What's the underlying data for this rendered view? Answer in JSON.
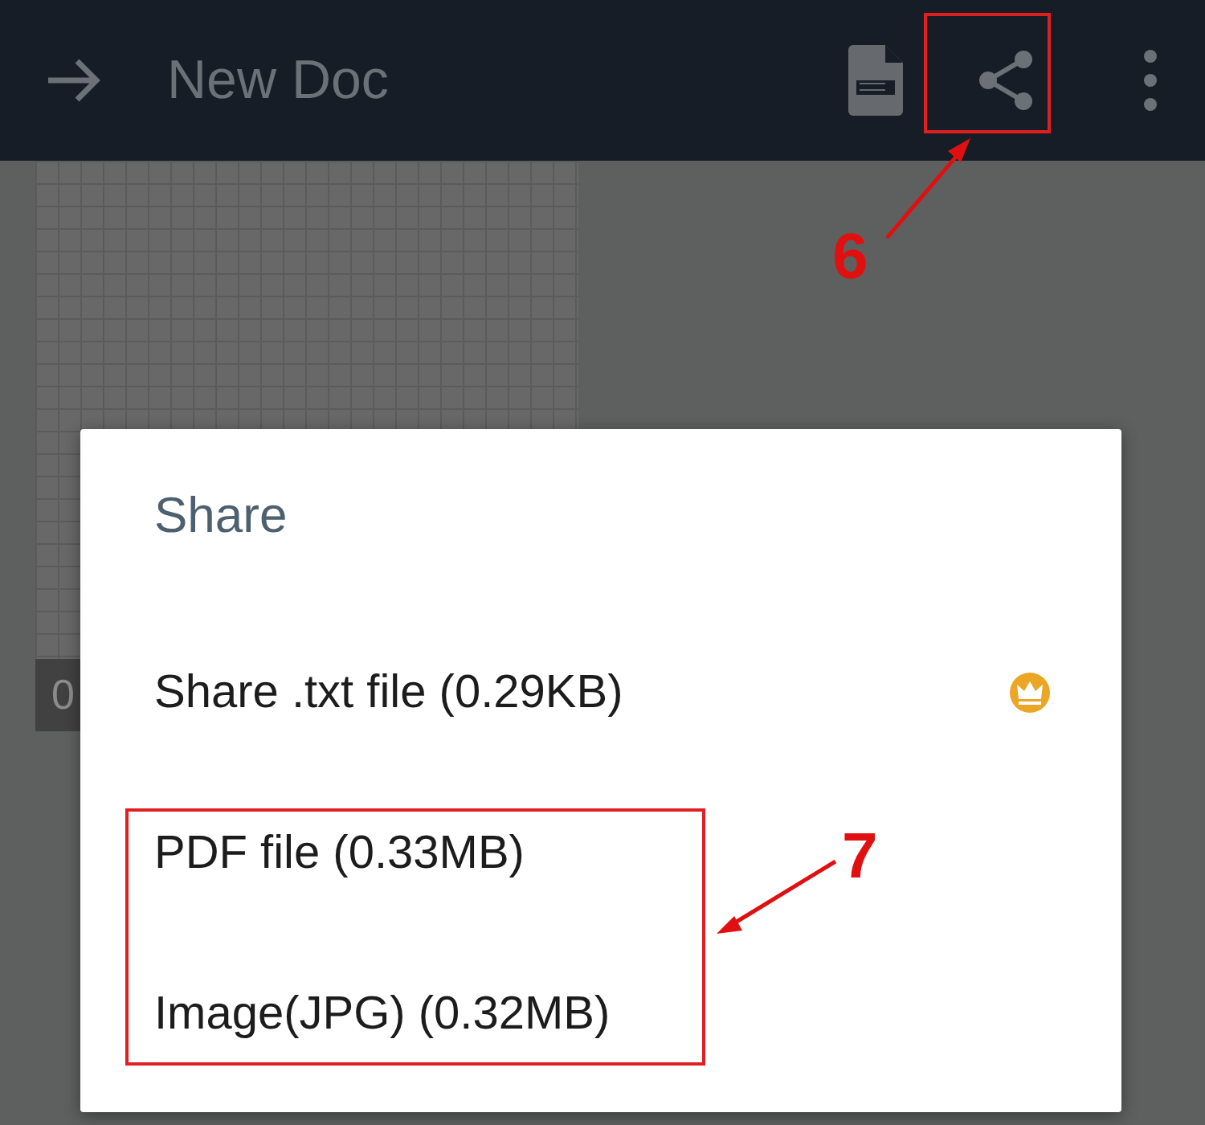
{
  "app_bar": {
    "title": "New Doc"
  },
  "page_badge": "0",
  "dialog": {
    "title": "Share",
    "items": [
      {
        "label": "Share .txt file (0.29KB)",
        "premium": true
      },
      {
        "label": "PDF file (0.33MB)",
        "premium": false
      },
      {
        "label": "Image(JPG) (0.32MB)",
        "premium": false
      }
    ]
  },
  "annotations": [
    {
      "label": "6"
    },
    {
      "label": "7"
    }
  ]
}
